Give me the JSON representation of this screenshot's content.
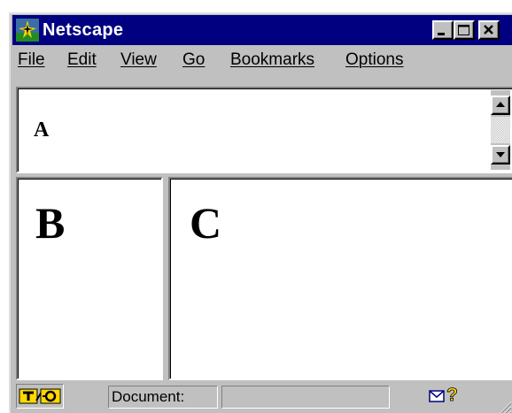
{
  "window": {
    "title": "Netscape",
    "title_bar_color": "#000080",
    "face_color": "#c0c0c0",
    "app_icon": "netscape-icon",
    "controls": {
      "minimize": "minimize-icon",
      "maximize": "maximize-icon",
      "close": "close-icon"
    }
  },
  "menubar": {
    "items": [
      "File",
      "Edit",
      "View",
      "Go",
      "Bookmarks",
      "Options"
    ]
  },
  "frames": {
    "top": {
      "label": "A"
    },
    "left": {
      "label": "B"
    },
    "right": {
      "label": "C"
    }
  },
  "scrollbar": {
    "up_icon": "arrow-up-icon",
    "down_icon": "arrow-down-icon"
  },
  "statusbar": {
    "security_icon": "security-key-icon",
    "status_text": "Document:",
    "progress_text": "",
    "mail_icon": "mail-icon",
    "help_icon": "question-mark-icon",
    "grip_icon": "resize-grip-icon"
  }
}
